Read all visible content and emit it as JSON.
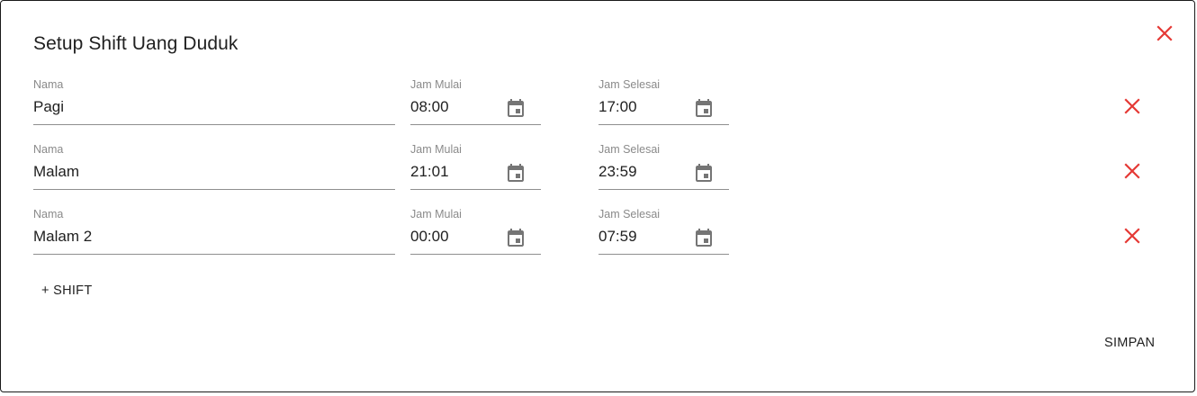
{
  "dialog": {
    "title": "Setup Shift Uang Duduk"
  },
  "labels": {
    "nama": "Nama",
    "jam_mulai": "Jam Mulai",
    "jam_selesai": "Jam Selesai"
  },
  "shifts": [
    {
      "nama": "Pagi",
      "jam_mulai": "08:00",
      "jam_selesai": "17:00"
    },
    {
      "nama": "Malam",
      "jam_mulai": "21:01",
      "jam_selesai": "23:59"
    },
    {
      "nama": "Malam 2",
      "jam_mulai": "00:00",
      "jam_selesai": "07:59"
    }
  ],
  "actions": {
    "add_shift": "+ SHIFT",
    "save": "SIMPAN"
  },
  "icons": {
    "close": "close-icon",
    "calendar": "calendar-icon"
  },
  "colors": {
    "close": "#e53935",
    "calendar": "#757575",
    "underline": "#8f8f8f",
    "label": "#8a8a8a",
    "text": "#212121"
  }
}
